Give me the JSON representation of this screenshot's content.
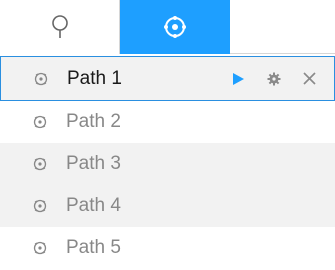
{
  "tabs": [
    {
      "icon": "search-pin-icon",
      "active": false
    },
    {
      "icon": "patrol-target-icon",
      "active": true
    }
  ],
  "paths": [
    {
      "label": "Path 1",
      "selected": true
    },
    {
      "label": "Path 2",
      "selected": false
    },
    {
      "label": "Path 3",
      "selected": false
    },
    {
      "label": "Path 4",
      "selected": false
    },
    {
      "label": "Path 5",
      "selected": false
    }
  ],
  "actions": [
    {
      "icon": "play-icon"
    },
    {
      "icon": "gear-icon"
    },
    {
      "icon": "close-icon"
    }
  ],
  "colors": {
    "accent": "#1e9fff",
    "play": "#1e9fff",
    "selected_border": "#2a8fe0",
    "row_alt": "#f2f2f2",
    "icon_gray": "#888888"
  }
}
